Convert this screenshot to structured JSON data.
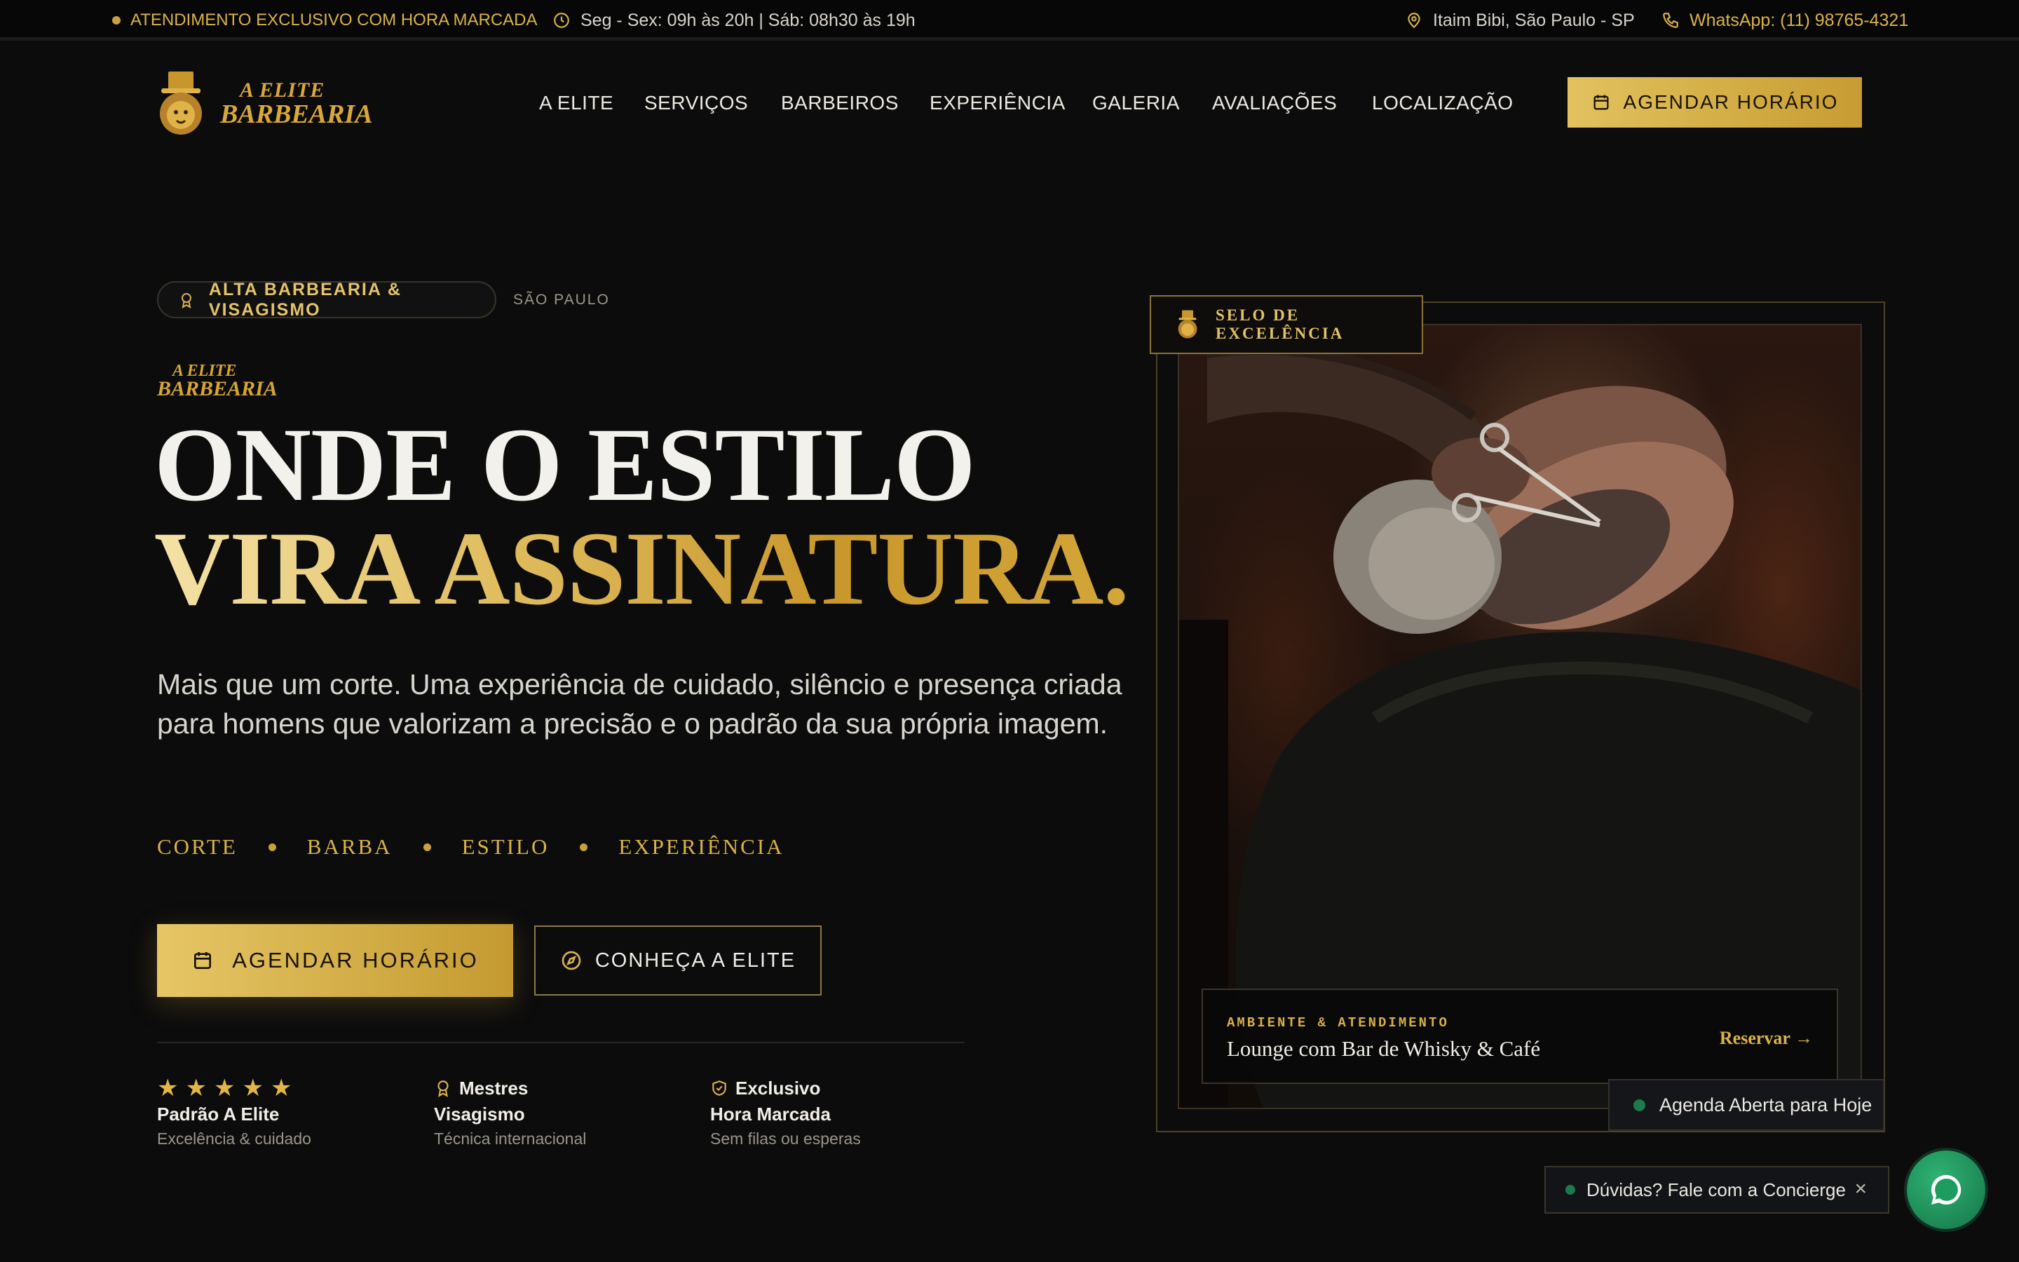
{
  "topbar": {
    "exclusive": "ATENDIMENTO EXCLUSIVO COM HORA MARCADA",
    "hours": "Seg - Sex: 09h às 20h | Sáb: 08h30 às 19h",
    "location": "Itaim Bibi, São Paulo - SP",
    "whatsapp": "WhatsApp: (11) 98765-4321"
  },
  "brand": {
    "line1": "A ELITE",
    "line2": "BARBEARIA"
  },
  "nav": {
    "items": [
      "A ELITE",
      "SERVIÇOS",
      "BARBEIROS",
      "EXPERIÊNCIA",
      "GALERIA",
      "AVALIAÇÕES",
      "LOCALIZAÇÃO"
    ],
    "cta": "AGENDAR HORÁRIO"
  },
  "hero": {
    "pill": "ALTA BARBEARIA & VISAGISMO",
    "pill_sub": "SÃO PAULO",
    "title_line1": "ONDE O ESTILO",
    "title_line2": "VIRA ASSINATURA.",
    "lead": "Mais que um corte. Uma experiência de cuidado, silêncio e presença criada para homens que valorizam a precisão e o padrão da sua própria imagem.",
    "tags": [
      "CORTE",
      "BARBA",
      "ESTILO",
      "EXPERIÊNCIA"
    ],
    "primary_button": "AGENDAR HORÁRIO",
    "secondary_button": "CONHEÇA A ELITE",
    "stats": [
      {
        "head": "",
        "title": "Padrão A Elite",
        "sub": "Excelência & cuidado",
        "stars": 5
      },
      {
        "head": "Mestres",
        "title": "Visagismo",
        "sub": "Técnica internacional"
      },
      {
        "head": "Exclusivo",
        "title": "Hora Marcada",
        "sub": "Sem filas ou esperas"
      }
    ]
  },
  "showcase": {
    "seal": "SELO DE EXCELÊNCIA",
    "kicker": "AMBIENTE & ATENDIMENTO",
    "title": "Lounge com Bar de Whisky & Café",
    "link": "Reservar →",
    "status": "Agenda Aberta para Hoje"
  },
  "concierge": {
    "label": "Dúvidas? Fale com a Concierge",
    "close": "×"
  },
  "colors": {
    "gold": "#d9b24a",
    "background": "#0c0c0d",
    "status_green": "#1c7a4d"
  },
  "icons": [
    "clock-icon",
    "map-pin-icon",
    "phone-icon",
    "calendar-icon",
    "award-icon",
    "compass-icon",
    "shield-check-icon",
    "star-icon",
    "chat-icon",
    "close-icon"
  ]
}
